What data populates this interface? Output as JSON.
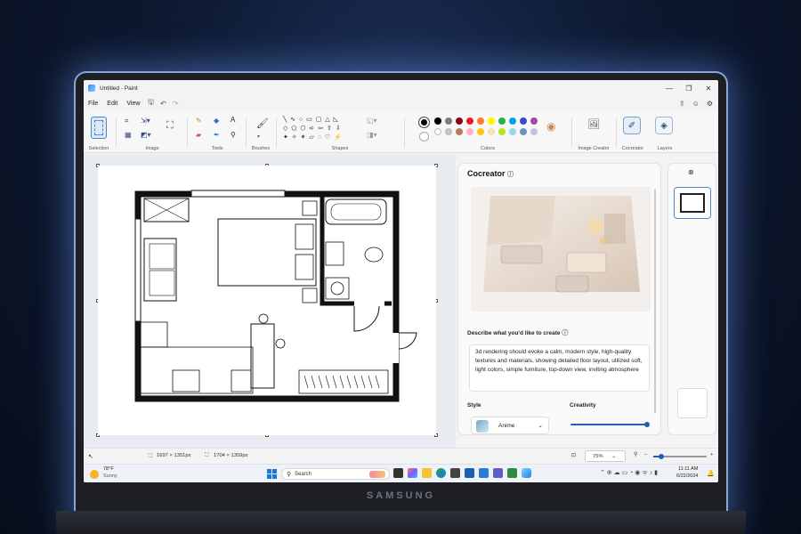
{
  "window": {
    "title": "Untitled - Paint"
  },
  "menu": {
    "file": "File",
    "edit": "Edit",
    "view": "View"
  },
  "ribbon": {
    "groups": {
      "selection": "Selection",
      "image": "Image",
      "tools": "Tools",
      "brushes": "Brushes",
      "shapes": "Shapes",
      "colors": "Colors",
      "image_creator": "Image Creator",
      "cocreator": "Cocreator",
      "layers": "Layers"
    },
    "colors": {
      "current_primary": "#000000",
      "current_secondary": "#ffffff",
      "palette_row1": [
        "#000000",
        "#7f7f7f",
        "#880015",
        "#ed1c24",
        "#ff7f27",
        "#fff200",
        "#22b14c",
        "#00a2e8",
        "#3f48cc",
        "#a349a4"
      ],
      "palette_row2": [
        "#ffffff",
        "#c3c3c3",
        "#b97a57",
        "#ffaec9",
        "#ffc90e",
        "#efe4b0",
        "#b5e61d",
        "#99d9ea",
        "#7092be",
        "#c8bfe7"
      ]
    }
  },
  "cocreator": {
    "title": "Cocreator",
    "prompt_label": "Describe what you'd like to create",
    "prompt_text": "3d rendering should evoke a calm, modern style, high-quality textures and materials, showing detailed floor layout, utilized soft, light colors, simple furniture, top-down view, inviting atmosphere",
    "style_label": "Style",
    "style_value": "Anime",
    "creativity_label": "Creativity",
    "creativity_level": 0.95
  },
  "status": {
    "selection_size": "1697 × 1351px",
    "canvas_size": "1704 × 1359px",
    "zoom": "75%"
  },
  "taskbar": {
    "weather_temp": "78°F",
    "weather_text": "Sunny",
    "search_placeholder": "Search",
    "time": "11:11 AM",
    "date": "6/22/2024"
  },
  "device": {
    "brand": "SAMSUNG"
  }
}
